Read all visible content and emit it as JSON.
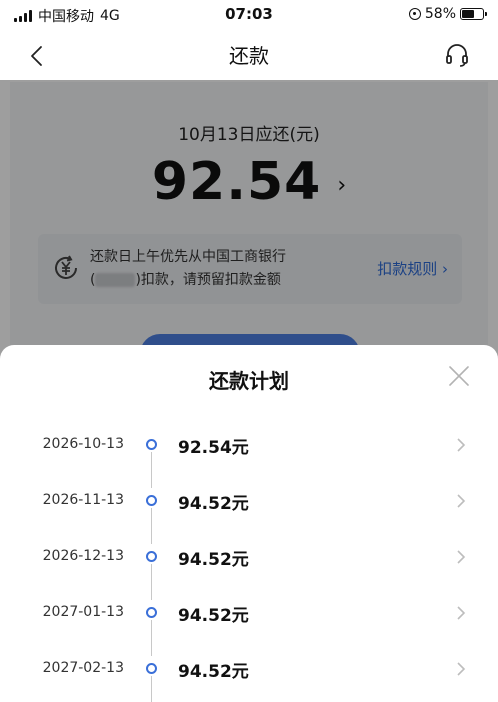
{
  "status_bar": {
    "carrier": "中国移动",
    "network": "4G",
    "time": "07:03",
    "battery": "58%",
    "battery_level": 0.58
  },
  "nav": {
    "title": "还款",
    "back_icon": "chevron-left-icon",
    "service_icon": "headset-icon"
  },
  "summary": {
    "due_label": "10月13日应还(元)",
    "amount": "92.54",
    "amount_chevron": "›",
    "notice_line1": "还款日上午优先从中国工商银行",
    "notice_line2_prefix": "(",
    "notice_line2_suffix": ")扣款，请预留扣款金额",
    "rules_link": "扣款规则 ›"
  },
  "plan_sheet": {
    "title": "还款计划",
    "close_icon": "close-icon",
    "items": [
      {
        "date": "2026-10-13",
        "amount": "92.54元"
      },
      {
        "date": "2026-11-13",
        "amount": "94.52元"
      },
      {
        "date": "2026-12-13",
        "amount": "94.52元"
      },
      {
        "date": "2027-01-13",
        "amount": "94.52元"
      },
      {
        "date": "2027-02-13",
        "amount": "94.52元"
      }
    ]
  },
  "colors": {
    "accent": "#3a6fd8",
    "link": "#2d6ad6",
    "overlay": "rgba(0,0,0,0.38)"
  }
}
